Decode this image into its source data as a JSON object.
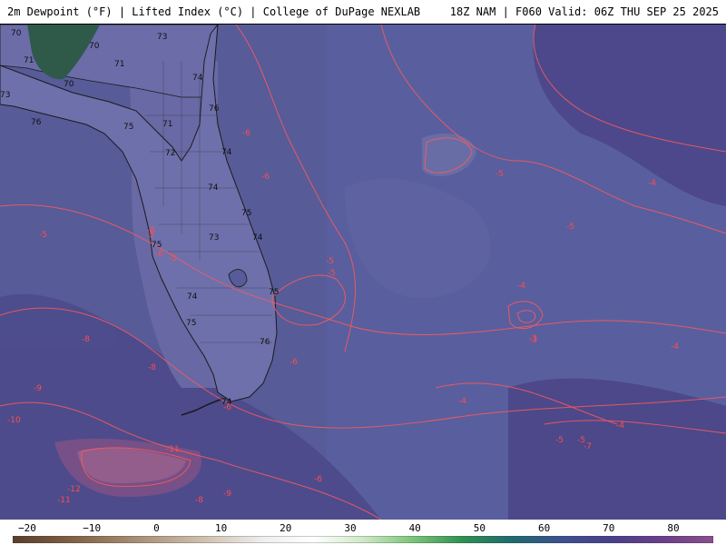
{
  "header": {
    "title": "2m Dewpoint (°F) | Lifted Index (°C) | College of DuPage NEXLAB",
    "run_info": "18Z NAM | F060 Valid: 06Z THU SEP 25 2025"
  },
  "map": {
    "background_color": "#5a5f9c",
    "contour_color": "#ff5a5a",
    "land_label_color": "#111111",
    "lifted_index_labels": [
      "-6",
      "-6",
      "-5",
      "-5",
      "-5",
      "-5",
      "-5",
      "-5",
      "-6",
      "-6",
      "-5",
      "-3",
      "-4",
      "-4",
      "-4",
      "-4",
      "-4",
      "-5",
      "-5",
      "-7",
      "-6",
      "-8",
      "-8",
      "-9",
      "-10",
      "-11",
      "-11",
      "-12",
      "-8",
      "-9",
      "-8",
      "-6",
      "-3"
    ],
    "dewpoint_labels": [
      "66",
      "70",
      "70",
      "71",
      "71",
      "70",
      "73",
      "74",
      "76",
      "76",
      "75",
      "71",
      "72",
      "74",
      "74",
      "75",
      "73",
      "74",
      "75",
      "74",
      "75",
      "76",
      "75",
      "74",
      "73"
    ]
  },
  "colorbar": {
    "tick_labels": [
      "−20",
      "−10",
      "0",
      "10",
      "20",
      "30",
      "40",
      "50",
      "60",
      "70",
      "80"
    ],
    "stops": [
      "#5a3e2b",
      "#7a5a40",
      "#9a7d62",
      "#b7a28a",
      "#d4c8b8",
      "#eeeeee",
      "#ffffff",
      "#cfe9c5",
      "#7cc47a",
      "#2f8f52",
      "#1f6a6f",
      "#3d4f8f",
      "#4a3f8a",
      "#6b3f8a",
      "#8a4f8f"
    ]
  }
}
